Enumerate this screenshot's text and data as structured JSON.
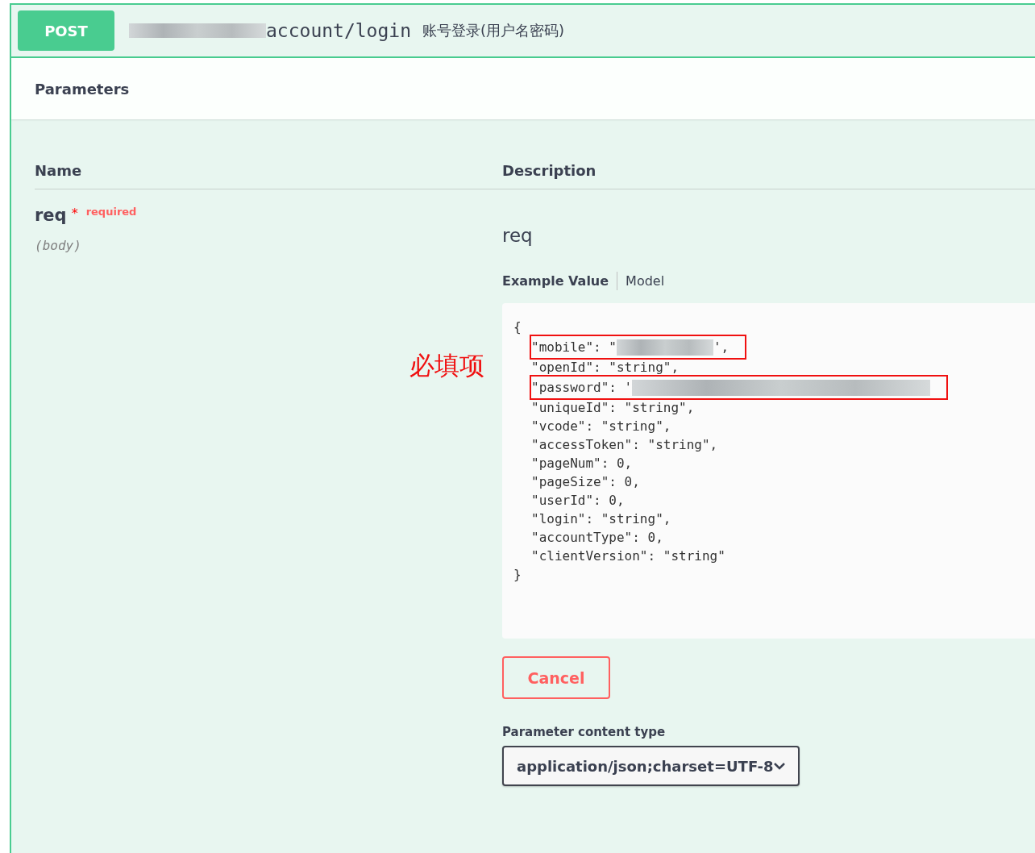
{
  "operation": {
    "method": "POST",
    "path_redacted": true,
    "path": "account/login",
    "summary": "账号登录(用户名密码)"
  },
  "section_title": "Parameters",
  "columns": [
    "Name",
    "Description"
  ],
  "parameter": {
    "name": "req",
    "required_mark": "*",
    "required_label": "required",
    "location": "(body)",
    "description": "req"
  },
  "annotation": "必填项",
  "example_tabs": [
    {
      "label": "Example Value",
      "selected": true
    },
    {
      "label": "Model",
      "selected": false
    }
  ],
  "code_lines": [
    {
      "kind": "brace",
      "text": "{",
      "boxed": false
    },
    {
      "kind": "redacted",
      "text": "\"mobile\": \"",
      "after": "',",
      "boxed": true
    },
    {
      "kind": "field",
      "text": "\"openId\": \"string\",",
      "boxed": false
    },
    {
      "kind": "redacted",
      "text": "\"password\": '",
      "boxed": true
    },
    {
      "kind": "field",
      "text": "\"uniqueId\": \"string\",",
      "boxed": false
    },
    {
      "kind": "field",
      "text": "\"vcode\": \"string\",",
      "boxed": false
    },
    {
      "kind": "field",
      "text": "\"accessToken\": \"string\",",
      "boxed": false
    },
    {
      "kind": "field",
      "text": "\"pageNum\": 0,",
      "boxed": false
    },
    {
      "kind": "field",
      "text": "\"pageSize\": 0,",
      "boxed": false
    },
    {
      "kind": "field",
      "text": "\"userId\": 0,",
      "boxed": false
    },
    {
      "kind": "field",
      "text": "\"login\": \"string\",",
      "boxed": false
    },
    {
      "kind": "field",
      "text": "\"accountType\": 0,",
      "boxed": false
    },
    {
      "kind": "field",
      "text": "\"clientVersion\": \"string\"",
      "boxed": false
    },
    {
      "kind": "brace",
      "text": "}",
      "boxed": false
    }
  ],
  "cancel_button": "Cancel",
  "content_type": {
    "label": "Parameter content type",
    "value": "application/json;charset=UTF-8"
  }
}
